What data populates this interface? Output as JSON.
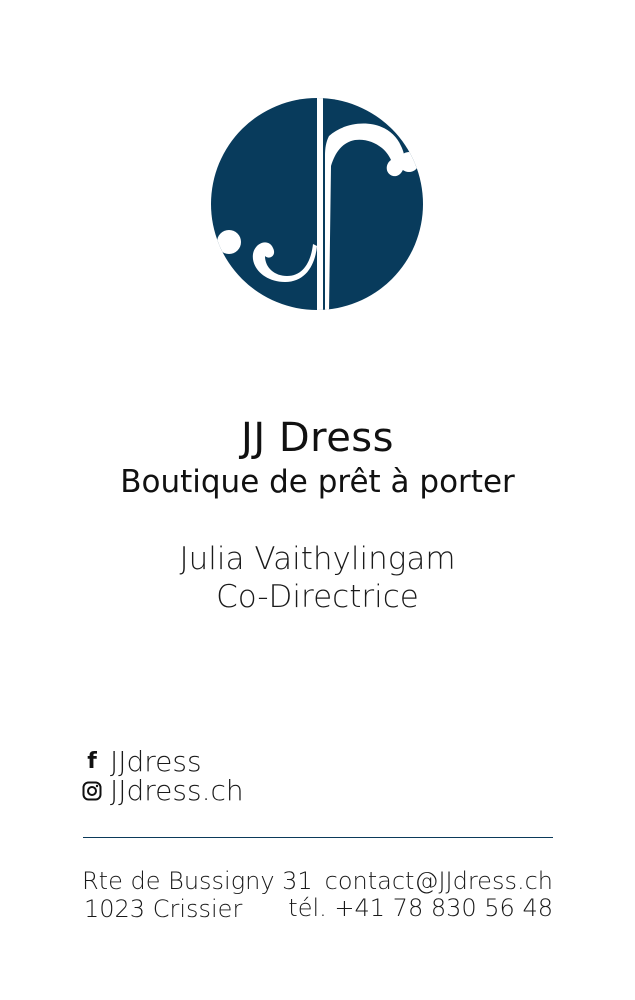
{
  "colors": {
    "brand_navy": "#083B5C",
    "divider": "#0B3A5A",
    "text": "#111111"
  },
  "logo": {
    "icon": "jj-monogram-logo"
  },
  "brand": {
    "name": "JJ Dress",
    "tagline": "Boutique de prêt à porter"
  },
  "person": {
    "name": "Julia Vaithylingam",
    "role": "Co-Directrice"
  },
  "social": [
    {
      "icon": "facebook-icon",
      "handle": "JJdress"
    },
    {
      "icon": "instagram-icon",
      "handle": "JJdress.ch"
    }
  ],
  "address": {
    "line1": "Rte de Bussigny 31",
    "line2": "1023 Crissier"
  },
  "contact": {
    "email": "contact@JJdress.ch",
    "phone": "tél. +41  78 830 56 48"
  }
}
